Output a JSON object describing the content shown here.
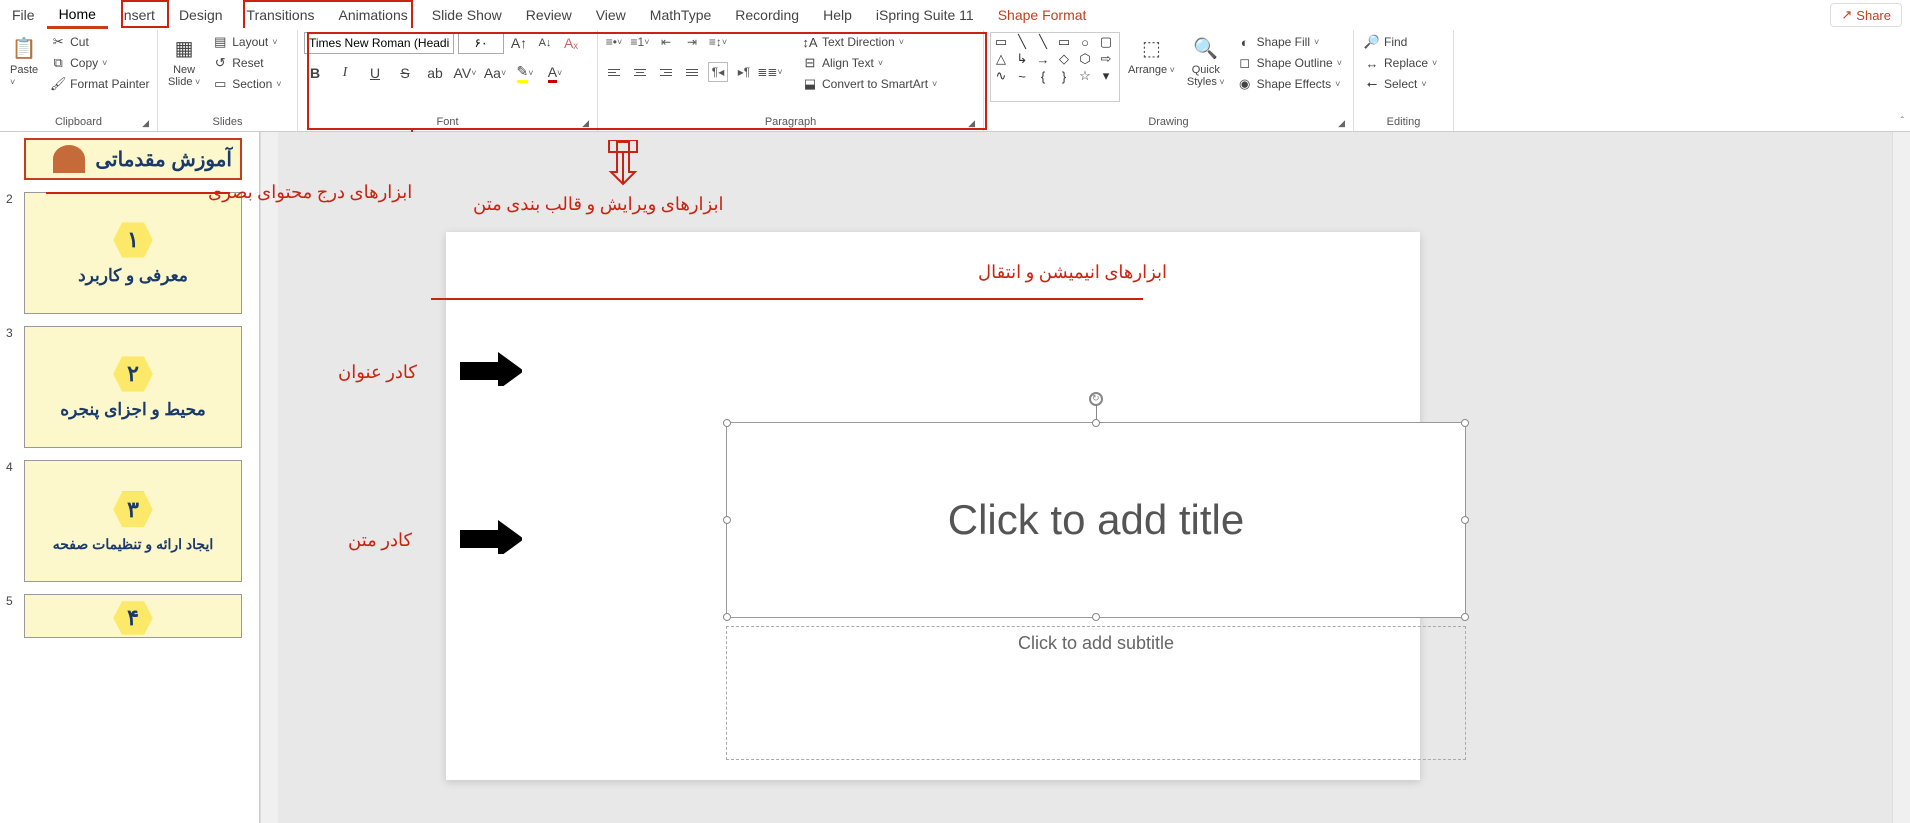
{
  "tabs": {
    "file": "File",
    "home": "Home",
    "insert": "Insert",
    "design": "Design",
    "transitions": "Transitions",
    "animations": "Animations",
    "slideshow": "Slide Show",
    "review": "Review",
    "view": "View",
    "mathtype": "MathType",
    "recording": "Recording",
    "help": "Help",
    "ispring": "iSpring Suite 11",
    "shapeformat": "Shape Format"
  },
  "share": "Share",
  "clipboard": {
    "label": "Clipboard",
    "paste": "Paste",
    "cut": "Cut",
    "copy": "Copy",
    "formatpainter": "Format Painter"
  },
  "slides": {
    "label": "Slides",
    "newslide": "New\nSlide",
    "layout": "Layout",
    "reset": "Reset",
    "section": "Section"
  },
  "font": {
    "label": "Font",
    "name": "Times New Roman (Headi",
    "size": "۶۰"
  },
  "paragraph": {
    "label": "Paragraph",
    "textdir": "Text Direction",
    "align": "Align Text",
    "smartart": "Convert to SmartArt"
  },
  "drawing": {
    "label": "Drawing",
    "arrange": "Arrange",
    "quickstyles": "Quick\nStyles",
    "shapefill": "Shape Fill",
    "shapeoutline": "Shape Outline",
    "shapeeffects": "Shape Effects"
  },
  "editing": {
    "label": "Editing",
    "find": "Find",
    "replace": "Replace",
    "select": "Select"
  },
  "slide": {
    "title_placeholder": "Click to add title",
    "subtitle_placeholder": "Click to add subtitle"
  },
  "thumbs": {
    "s1": "آموزش مقدماتی",
    "s2_num": "۱",
    "s2": "معرفی و کاربرد",
    "s3_num": "۲",
    "s3": "محیط و اجزای پنجره",
    "s4_num": "۳",
    "s4": "ایجاد ارائه و تنظیمات صفحه",
    "s5_num": "۴"
  },
  "ann": {
    "insert_tools": "ابزارهای درج محتوای بصری",
    "text_tools": "ابزارهای ویرایش و قالب بندی متن",
    "anim_tools": "ابزارهای انیمیشن و انتقال",
    "title_box": "کادر عنوان",
    "text_box": "کادر متن"
  }
}
